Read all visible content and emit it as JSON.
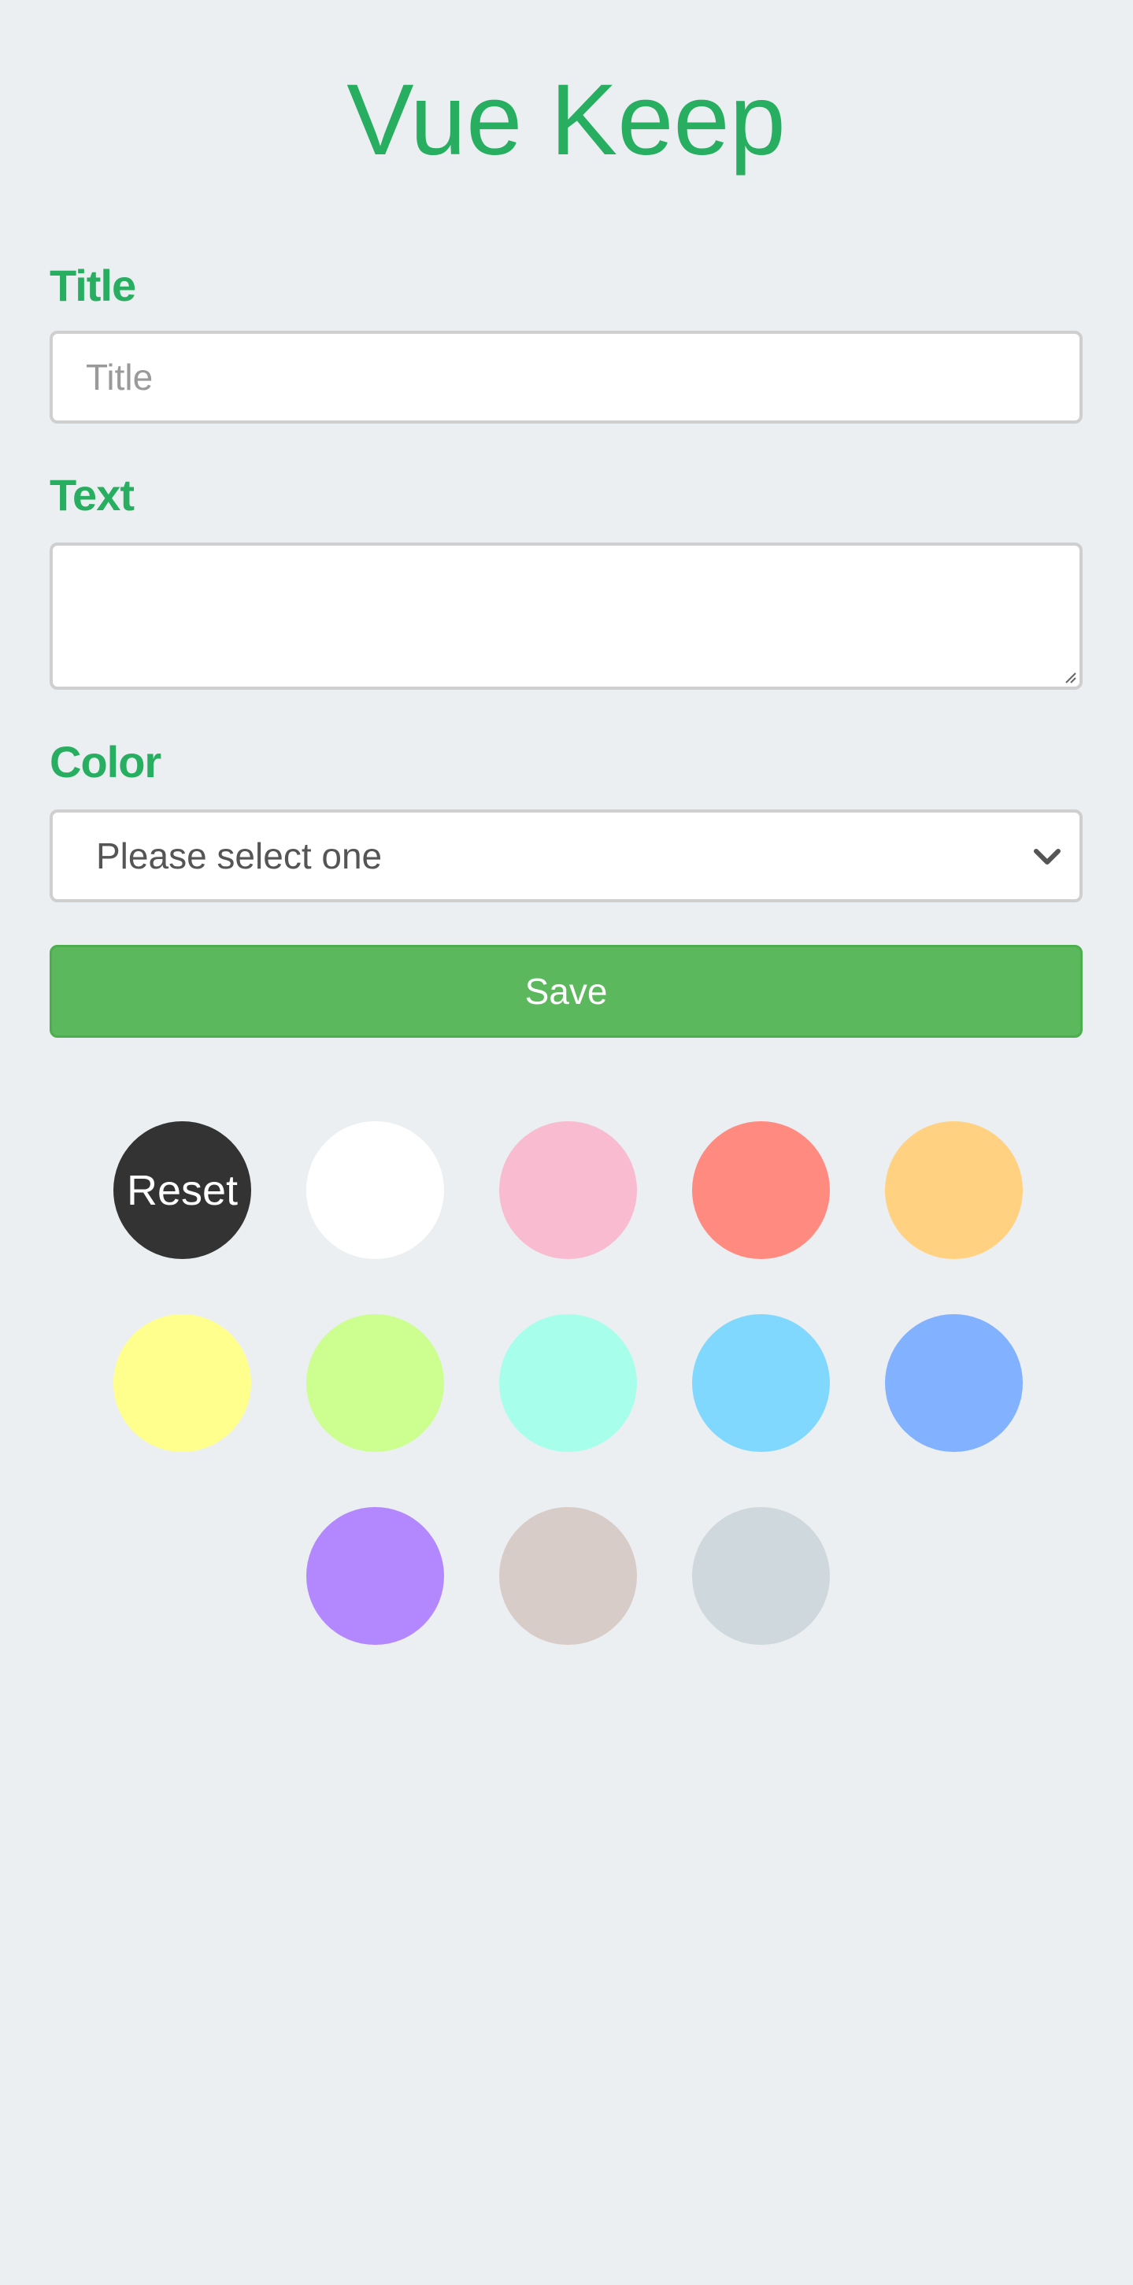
{
  "app": {
    "title": "Vue Keep"
  },
  "form": {
    "title_label": "Title",
    "title_placeholder": "Title",
    "title_value": "",
    "text_label": "Text",
    "text_value": "",
    "color_label": "Color",
    "color_selected": "Please select one",
    "save_label": "Save"
  },
  "swatches": [
    {
      "label": "Reset",
      "color": "#333333"
    },
    {
      "label": "",
      "color": "#ffffff"
    },
    {
      "label": "",
      "color": "#f8bbd0"
    },
    {
      "label": "",
      "color": "#ff8a80"
    },
    {
      "label": "",
      "color": "#ffd180"
    },
    {
      "label": "",
      "color": "#ffff8d"
    },
    {
      "label": "",
      "color": "#ccff90"
    },
    {
      "label": "",
      "color": "#a7ffeb"
    },
    {
      "label": "",
      "color": "#80d8ff"
    },
    {
      "label": "",
      "color": "#82b1ff"
    },
    {
      "label": "",
      "color": "#b388ff"
    },
    {
      "label": "",
      "color": "#d7ccc8"
    },
    {
      "label": "",
      "color": "#cfd8dc"
    }
  ]
}
